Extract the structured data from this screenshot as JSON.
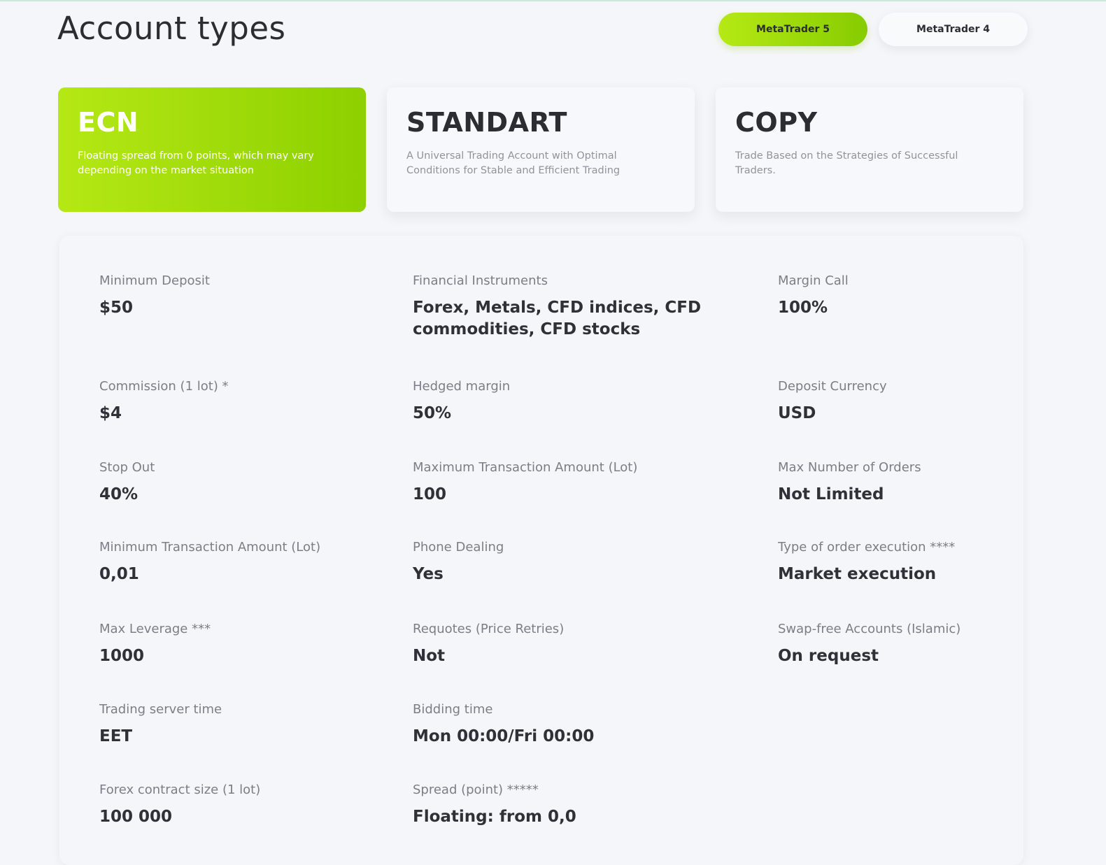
{
  "page": {
    "title": "Account types"
  },
  "platforms": [
    {
      "label": "MetaTrader 5",
      "active": true
    },
    {
      "label": "MetaTrader 4",
      "active": false
    }
  ],
  "account_cards": [
    {
      "title": "ECN",
      "description": "Floating spread from 0 points, which may vary depending on the market situation",
      "active": true
    },
    {
      "title": "STANDART",
      "description": "A Universal Trading Account with Optimal Conditions for Stable and Efficient Trading",
      "active": false
    },
    {
      "title": "COPY",
      "description": "Trade Based on the Strategies of Successful Traders.",
      "active": false
    }
  ],
  "specs": {
    "minimum_deposit": {
      "label": "Minimum Deposit",
      "value": "$50"
    },
    "financial_instruments": {
      "label": "Financial Instruments",
      "value": "Forex, Metals, CFD indices, CFD commodities, CFD stocks"
    },
    "margin_call": {
      "label": "Margin Call",
      "value": "100%"
    },
    "commission": {
      "label": "Commission (1 lot) *",
      "value": "$4"
    },
    "hedged_margin": {
      "label": "Hedged margin",
      "value": "50%"
    },
    "deposit_currency": {
      "label": "Deposit Currency",
      "value": "USD"
    },
    "stop_out": {
      "label": "Stop Out",
      "value": "40%"
    },
    "max_transaction": {
      "label": "Maximum Transaction Amount (Lot)",
      "value": "100"
    },
    "max_orders": {
      "label": "Max Number of Orders",
      "value": "Not Limited"
    },
    "min_transaction": {
      "label": "Minimum Transaction Amount (Lot)",
      "value": "0,01"
    },
    "phone_dealing": {
      "label": "Phone Dealing",
      "value": "Yes"
    },
    "order_execution": {
      "label": "Type of order execution ****",
      "value": "Market execution"
    },
    "max_leverage": {
      "label": "Max Leverage ***",
      "value": "1000"
    },
    "requotes": {
      "label": "Requotes (Price Retries)",
      "value": "Not"
    },
    "swap_free": {
      "label": "Swap-free Accounts (Islamic)",
      "value": "On request"
    },
    "server_time": {
      "label": "Trading server time",
      "value": "EET"
    },
    "bidding_time": {
      "label": "Bidding time",
      "value": "Mon 00:00/Fri 00:00"
    },
    "contract_size": {
      "label": "Forex contract size (1 lot)",
      "value": "100 000"
    },
    "spread": {
      "label": "Spread (point) *****",
      "value": "Floating: from 0,0"
    }
  }
}
